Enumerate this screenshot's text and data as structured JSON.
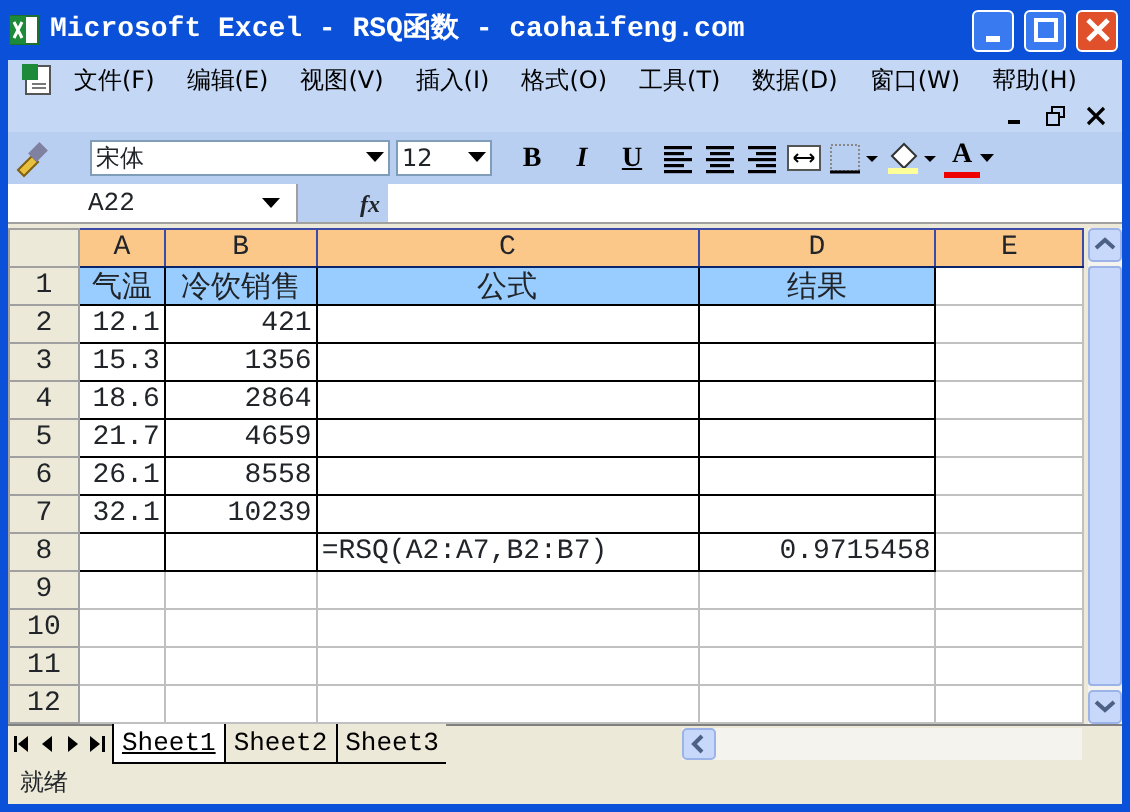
{
  "window": {
    "title": "Microsoft Excel - RSQ函数 - caohaifeng.com"
  },
  "menu": [
    "文件(F)",
    "编辑(E)",
    "视图(V)",
    "插入(I)",
    "格式(O)",
    "工具(T)",
    "数据(D)",
    "窗口(W)",
    "帮助(H)"
  ],
  "toolbar": {
    "font_name": "宋体",
    "font_size": "12",
    "bold": "B",
    "italic": "I",
    "underline": "U",
    "font_color": "A"
  },
  "formula_bar": {
    "name_box": "A22",
    "fx": "fx"
  },
  "columns": [
    "A",
    "B",
    "C",
    "D",
    "E"
  ],
  "rows": [
    {
      "header": "1",
      "bordered": true,
      "kind": "heading",
      "cells": {
        "A": {
          "kind": "label",
          "text": "气温"
        },
        "B": {
          "kind": "label",
          "text": "冷饮销售"
        },
        "C": {
          "kind": "label",
          "text": "公式"
        },
        "D": {
          "kind": "label",
          "text": "结果"
        }
      }
    },
    {
      "header": "2",
      "bordered": true,
      "kind": "data",
      "cells": {
        "A": {
          "kind": "number",
          "text": "12.1"
        },
        "B": {
          "kind": "number",
          "text": "421"
        }
      }
    },
    {
      "header": "3",
      "bordered": true,
      "kind": "data",
      "cells": {
        "A": {
          "kind": "number",
          "text": "15.3"
        },
        "B": {
          "kind": "number",
          "text": "1356"
        }
      }
    },
    {
      "header": "4",
      "bordered": true,
      "kind": "data",
      "cells": {
        "A": {
          "kind": "number",
          "text": "18.6"
        },
        "B": {
          "kind": "number",
          "text": "2864"
        }
      }
    },
    {
      "header": "5",
      "bordered": true,
      "kind": "data",
      "cells": {
        "A": {
          "kind": "number",
          "text": "21.7"
        },
        "B": {
          "kind": "number",
          "text": "4659"
        }
      }
    },
    {
      "header": "6",
      "bordered": true,
      "kind": "data",
      "cells": {
        "A": {
          "kind": "number",
          "text": "26.1"
        },
        "B": {
          "kind": "number",
          "text": "8558"
        }
      }
    },
    {
      "header": "7",
      "bordered": true,
      "kind": "data",
      "cells": {
        "A": {
          "kind": "number",
          "text": "32.1"
        },
        "B": {
          "kind": "number",
          "text": "10239"
        }
      }
    },
    {
      "header": "8",
      "bordered": true,
      "kind": "data",
      "cells": {
        "C": {
          "kind": "formula",
          "text": "=RSQ(A2:A7,B2:B7)"
        },
        "D": {
          "kind": "number",
          "text": "0.9715458"
        }
      }
    },
    {
      "header": "9",
      "bordered": false,
      "kind": "data"
    },
    {
      "header": "10",
      "bordered": false,
      "kind": "data"
    },
    {
      "header": "11",
      "bordered": false,
      "kind": "data"
    },
    {
      "header": "12",
      "bordered": false,
      "kind": "data"
    }
  ],
  "sheet_tabs": [
    {
      "label": "Sheet1",
      "selected": true
    },
    {
      "label": "Sheet2",
      "selected": false
    },
    {
      "label": "Sheet3",
      "selected": false
    }
  ],
  "status_bar": {
    "text": "就绪"
  }
}
